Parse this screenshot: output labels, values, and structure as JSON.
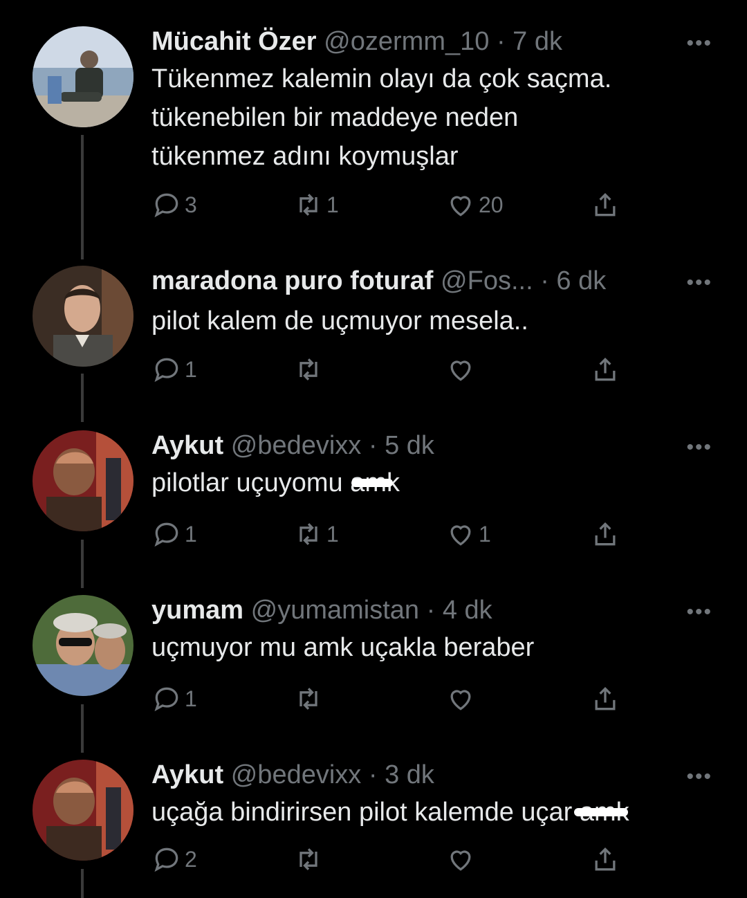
{
  "tweets": [
    {
      "name": "Mücahit Özer",
      "handle": "@ozermm_10",
      "time": "7 dk",
      "lines": [
        "Tükenmez kalemin olayı da çok saçma.",
        "tükenebilen bir maddeye neden",
        "tükenmez adını koymuşlar"
      ],
      "replies": "3",
      "retweets": "1",
      "likes": "20"
    },
    {
      "name": "maradona puro foturaf",
      "handle": "@Fos...",
      "time": "6 dk",
      "lines": [
        "pilot kalem de uçmuyor mesela.."
      ],
      "replies": "1",
      "retweets": "",
      "likes": ""
    },
    {
      "name": "Aykut",
      "handle": "@bedevixx",
      "time": "5 dk",
      "lines": [
        "pilotlar uçuyomu amk"
      ],
      "replies": "1",
      "retweets": "1",
      "likes": "1"
    },
    {
      "name": "yumam",
      "handle": "@yumamistan",
      "time": "4 dk",
      "lines": [
        "uçmuyor mu amk uçakla beraber"
      ],
      "replies": "1",
      "retweets": "",
      "likes": ""
    },
    {
      "name": "Aykut",
      "handle": "@bedevixx",
      "time": "3 dk",
      "lines": [
        "uçağa bindirirsen pilot kalemde uçar amk"
      ],
      "replies": "2",
      "retweets": "",
      "likes": ""
    }
  ],
  "separator": "·",
  "more_label": "•••"
}
